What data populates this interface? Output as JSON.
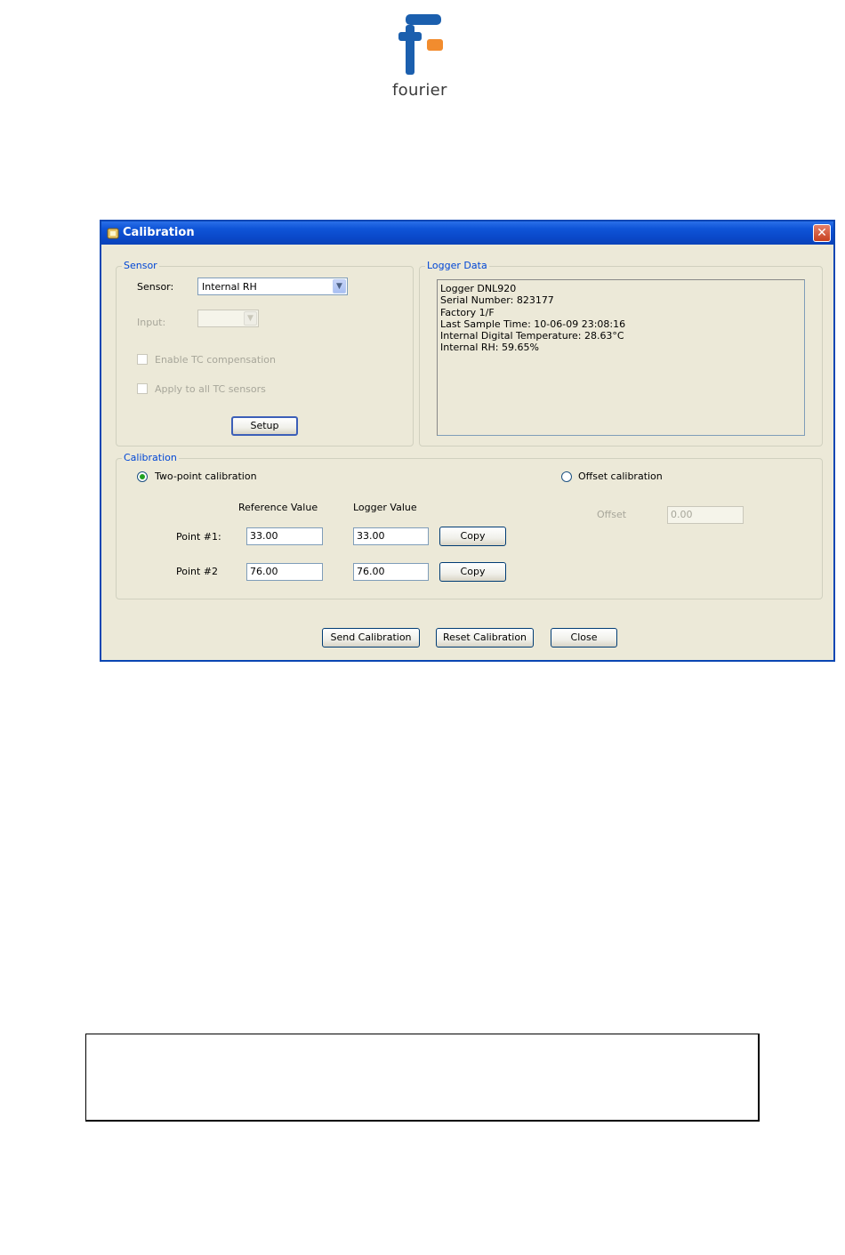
{
  "logo": {
    "text": "fourier",
    "colors": {
      "blue": "#1b5fae",
      "orange": "#f28c2e"
    }
  },
  "window": {
    "title": "Calibration",
    "close_symbol": "✕",
    "colors": {
      "titlebar": "#0a48c9",
      "group_label": "#0046d5",
      "face": "#ece9d8"
    }
  },
  "sensor_group": {
    "label": "Sensor",
    "sensor_label": "Sensor:",
    "sensor_value": "Internal RH",
    "input_label": "Input:",
    "input_value": "",
    "enable_tc_label": "Enable TC compensation",
    "apply_all_label": "Apply to all TC sensors",
    "setup_label": "Setup"
  },
  "logger_group": {
    "label": "Logger Data",
    "lines": [
      "Logger DNL920",
      "Serial Number: 823177",
      "Factory 1/F",
      "Last Sample Time: 10-06-09 23:08:16",
      "Internal Digital Temperature: 28.63°C",
      "Internal RH: 59.65%"
    ]
  },
  "calibration_group": {
    "label": "Calibration",
    "two_point_label": "Two-point calibration",
    "two_point_selected": true,
    "offset_label": "Offset calibration",
    "offset_selected": false,
    "reference_header": "Reference Value",
    "logger_header": "Logger Value",
    "points": [
      {
        "label": "Point #1:",
        "reference": "33.00",
        "logger": "33.00",
        "copy_label": "Copy"
      },
      {
        "label": "Point #2",
        "reference": "76.00",
        "logger": "76.00",
        "copy_label": "Copy"
      }
    ],
    "offset_field_label": "Offset",
    "offset_value": "0.00"
  },
  "footer": {
    "send_label": "Send Calibration",
    "reset_label": "Reset Calibration",
    "close_label": "Close"
  }
}
